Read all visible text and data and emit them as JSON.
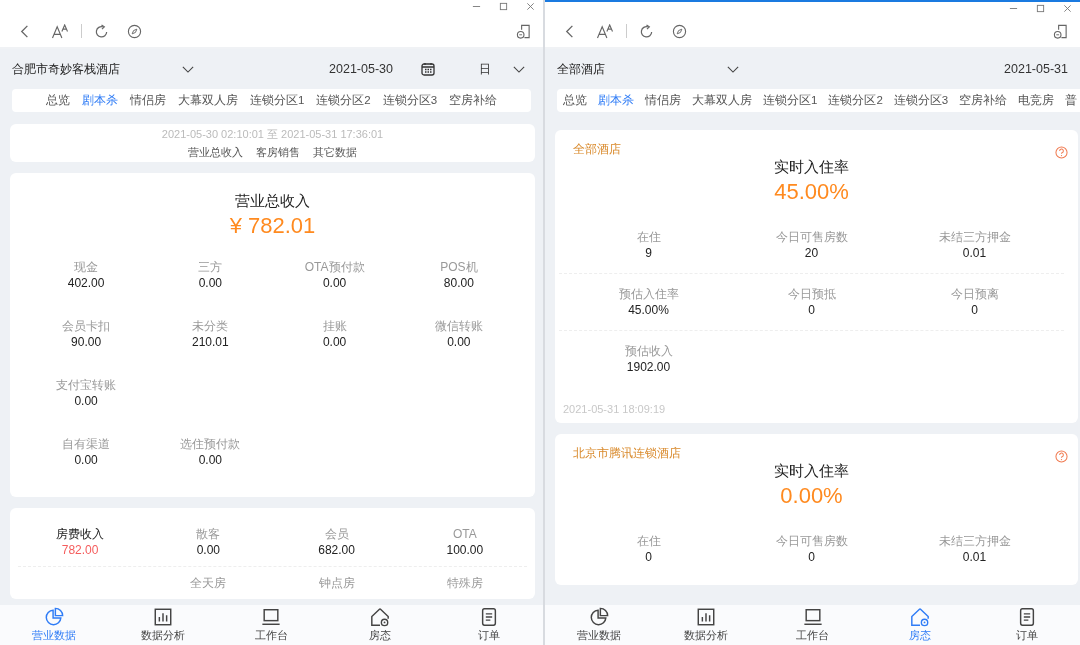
{
  "revenue_window": {
    "header": {
      "hotel": "合肥市奇妙客栈酒店",
      "date": "2021-05-30",
      "period": "日"
    },
    "tabs": [
      {
        "label": "总览",
        "selected": false
      },
      {
        "label": "剧本杀",
        "selected": true
      },
      {
        "label": "情侣房",
        "selected": false
      },
      {
        "label": "大幕双人房",
        "selected": false
      },
      {
        "label": "连锁分区1",
        "selected": false
      },
      {
        "label": "连锁分区2",
        "selected": false
      },
      {
        "label": "连锁分区3",
        "selected": false
      },
      {
        "label": "空房补给",
        "selected": false
      }
    ],
    "period_card": {
      "range": "2021-05-30 02:10:01 至 2021-05-31 17:36:01",
      "links": [
        "营业总收入",
        "客房销售",
        "其它数据"
      ]
    },
    "revenue_card": {
      "title": "营业总收入",
      "amount": "¥ 782.01",
      "rows": [
        [
          {
            "label": "现金",
            "value": "402.00"
          },
          {
            "label": "三方",
            "value": "0.00"
          },
          {
            "label": "OTA预付款",
            "value": "0.00"
          },
          {
            "label": "POS机",
            "value": "80.00"
          }
        ],
        [
          {
            "label": "会员卡扣",
            "value": "90.00"
          },
          {
            "label": "未分类",
            "value": "210.01"
          },
          {
            "label": "挂账",
            "value": "0.00"
          },
          {
            "label": "微信转账",
            "value": "0.00"
          }
        ],
        [
          {
            "label": "支付宝转账",
            "value": "0.00"
          }
        ],
        [
          {
            "label": "自有渠道",
            "value": "0.00"
          },
          {
            "label": "选住预付款",
            "value": "0.00"
          }
        ]
      ]
    },
    "room_card": {
      "rows": [
        {
          "lead_empty": false,
          "items": [
            {
              "label": "房费收入",
              "value": "782.00",
              "highlight": true
            },
            {
              "label": "散客",
              "value": "0.00",
              "highlight": false
            },
            {
              "label": "会员",
              "value": "682.00",
              "highlight": false
            },
            {
              "label": "OTA",
              "value": "100.00",
              "highlight": false
            }
          ]
        },
        {
          "lead_empty": true,
          "items": [
            {
              "label": "全天房",
              "highlight": false
            },
            {
              "label": "钟点房",
              "highlight": false
            },
            {
              "label": "特殊房",
              "highlight": false
            }
          ]
        }
      ]
    },
    "nav": [
      {
        "label": "营业数据",
        "selected": true
      },
      {
        "label": "数据分析",
        "selected": false
      },
      {
        "label": "工作台",
        "selected": false
      },
      {
        "label": "房态",
        "selected": false
      },
      {
        "label": "订单",
        "selected": false
      }
    ]
  },
  "room_status_window": {
    "header": {
      "hotel": "全部酒店",
      "date": "2021-05-31"
    },
    "tabs": [
      {
        "label": "总览",
        "selected": false
      },
      {
        "label": "剧本杀",
        "selected": true
      },
      {
        "label": "情侣房",
        "selected": false
      },
      {
        "label": "大幕双人房",
        "selected": false
      },
      {
        "label": "连锁分区1",
        "selected": false
      },
      {
        "label": "连锁分区2",
        "selected": false
      },
      {
        "label": "连锁分区3",
        "selected": false
      },
      {
        "label": "空房补给",
        "selected": false
      },
      {
        "label": "电竞房",
        "selected": false
      },
      {
        "label": "普",
        "selected": false
      }
    ],
    "cards": [
      {
        "hotel": "全部酒店",
        "title": "实时入住率",
        "rate": "45.00%",
        "rows": [
          [
            {
              "label": "在住",
              "value": "9"
            },
            {
              "label": "今日可售房数",
              "value": "20"
            },
            {
              "label": "未结三方押金",
              "value": "0.01"
            }
          ],
          [
            {
              "label": "预估入住率",
              "value": "45.00%"
            },
            {
              "label": "今日预抵",
              "value": "0"
            },
            {
              "label": "今日预离",
              "value": "0"
            }
          ],
          [
            {
              "label": "预估收入",
              "value": "1902.00"
            }
          ]
        ],
        "timestamp": "2021-05-31 18:09:19"
      },
      {
        "hotel": "北京市腾讯连锁酒店",
        "title": "实时入住率",
        "rate": "0.00%",
        "rows": [
          [
            {
              "label": "在住",
              "value": "0"
            },
            {
              "label": "今日可售房数",
              "value": "0"
            },
            {
              "label": "未结三方押金",
              "value": "0.01"
            }
          ]
        ]
      }
    ],
    "nav": [
      {
        "label": "营业数据",
        "selected": false
      },
      {
        "label": "数据分析",
        "selected": false
      },
      {
        "label": "工作台",
        "selected": false
      },
      {
        "label": "房态",
        "selected": true
      },
      {
        "label": "订单",
        "selected": false
      }
    ]
  }
}
